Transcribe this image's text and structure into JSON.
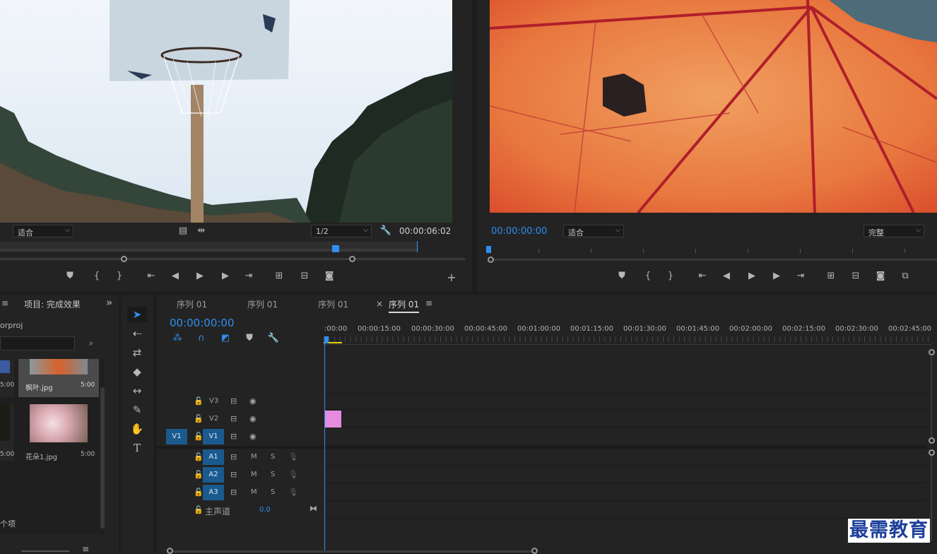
{
  "source_monitor": {
    "fit_label": "适合",
    "resolution_label": "1/2",
    "timecode": "00:00:06:02"
  },
  "program_monitor": {
    "timecode": "00:00:00:00",
    "fit_label": "适合",
    "quality_label": "完整"
  },
  "project_panel": {
    "menu_icon": "≡",
    "title": "项目: 完成效果",
    "overflow_icon": "»",
    "file_name": "orproj",
    "items": [
      {
        "name": "枫叶.jpg",
        "duration": "5:00"
      },
      {
        "name": "花朵1.jpg",
        "duration": "5:00"
      }
    ],
    "left_durations": [
      "5:00",
      "5:00"
    ],
    "items_label": "个项"
  },
  "timeline": {
    "tabs": [
      "序列 01",
      "序列 01",
      "序列 01",
      "序列 01"
    ],
    "close_icon": "×",
    "tab_menu_icon": "≡",
    "timecode": "00:00:00:00",
    "ruler_labels": [
      ":00:00",
      "00:00:15:00",
      "00:00:30:00",
      "00:00:45:00",
      "00:01:00:00",
      "00:01:15:00",
      "00:01:30:00",
      "00:01:45:00",
      "00:02:00:00",
      "00:02:15:00",
      "00:02:30:00",
      "00:02:45:00"
    ],
    "video_tracks": [
      "V3",
      "V2",
      "V1"
    ],
    "source_patch": "V1",
    "audio_tracks": [
      "A1",
      "A2",
      "A3"
    ],
    "mute_label": "M",
    "solo_label": "S",
    "master_label": "主声道",
    "master_value": "0.0"
  },
  "watermark": "最需教育",
  "colors": {
    "accent_blue": "#2f8ff0",
    "track_blue": "#1a5a8e",
    "clip_pink": "#e58be0",
    "playhead_yellow": "#e8d000"
  }
}
